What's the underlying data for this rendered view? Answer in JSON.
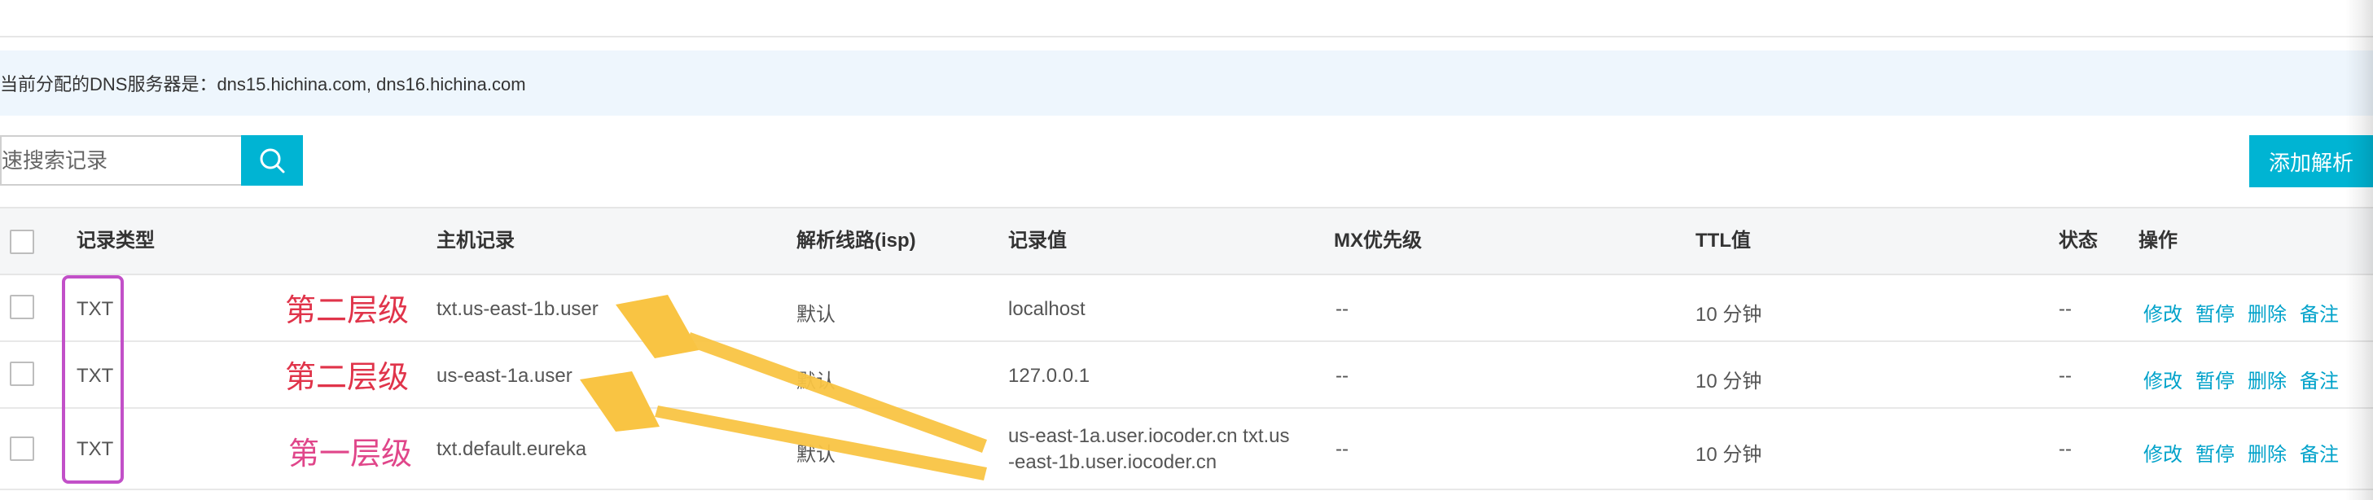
{
  "dns_info": "当前分配的DNS服务器是：dns15.hichina.com, dns16.hichina.com",
  "search": {
    "placeholder": "快速搜索记录"
  },
  "add_button": "添加解析",
  "table": {
    "headers": {
      "type": "记录类型",
      "host": "主机记录",
      "line": "解析线路(isp)",
      "value": "记录值",
      "mx": "MX优先级",
      "ttl": "TTL值",
      "status": "状态",
      "ops": "操作"
    },
    "rows": [
      {
        "type": "TXT",
        "host": "txt.us-east-1b.user",
        "line": "默认",
        "value": "localhost",
        "mx": "--",
        "ttl": "10 分钟",
        "status": "--"
      },
      {
        "type": "TXT",
        "host": "us-east-1a.user",
        "line": "默认",
        "value": "127.0.0.1",
        "mx": "--",
        "ttl": "10 分钟",
        "status": "--"
      },
      {
        "type": "TXT",
        "host": "txt.default.eureka",
        "line": "默认",
        "value_line1": "us-east-1a.user.iocoder.cn txt.us",
        "value_line2": "-east-1b.user.iocoder.cn",
        "mx": "--",
        "ttl": "10 分钟",
        "status": "--"
      }
    ],
    "actions": {
      "edit": "修改",
      "pause": "暂停",
      "delete": "删除",
      "note": "备注"
    }
  },
  "annotations": {
    "level2_a": "第二层级",
    "level2_b": "第二层级",
    "level1": "第一层级",
    "color_red": "#e0344a",
    "color_pink": "#e0468a",
    "color_box": "#c250c8",
    "color_arrow": "#f9c443"
  },
  "colors": {
    "accent": "#00b4d3",
    "link": "#00a2ca",
    "info_bg": "#eef6fd",
    "header_bg": "#f5f6f7"
  }
}
